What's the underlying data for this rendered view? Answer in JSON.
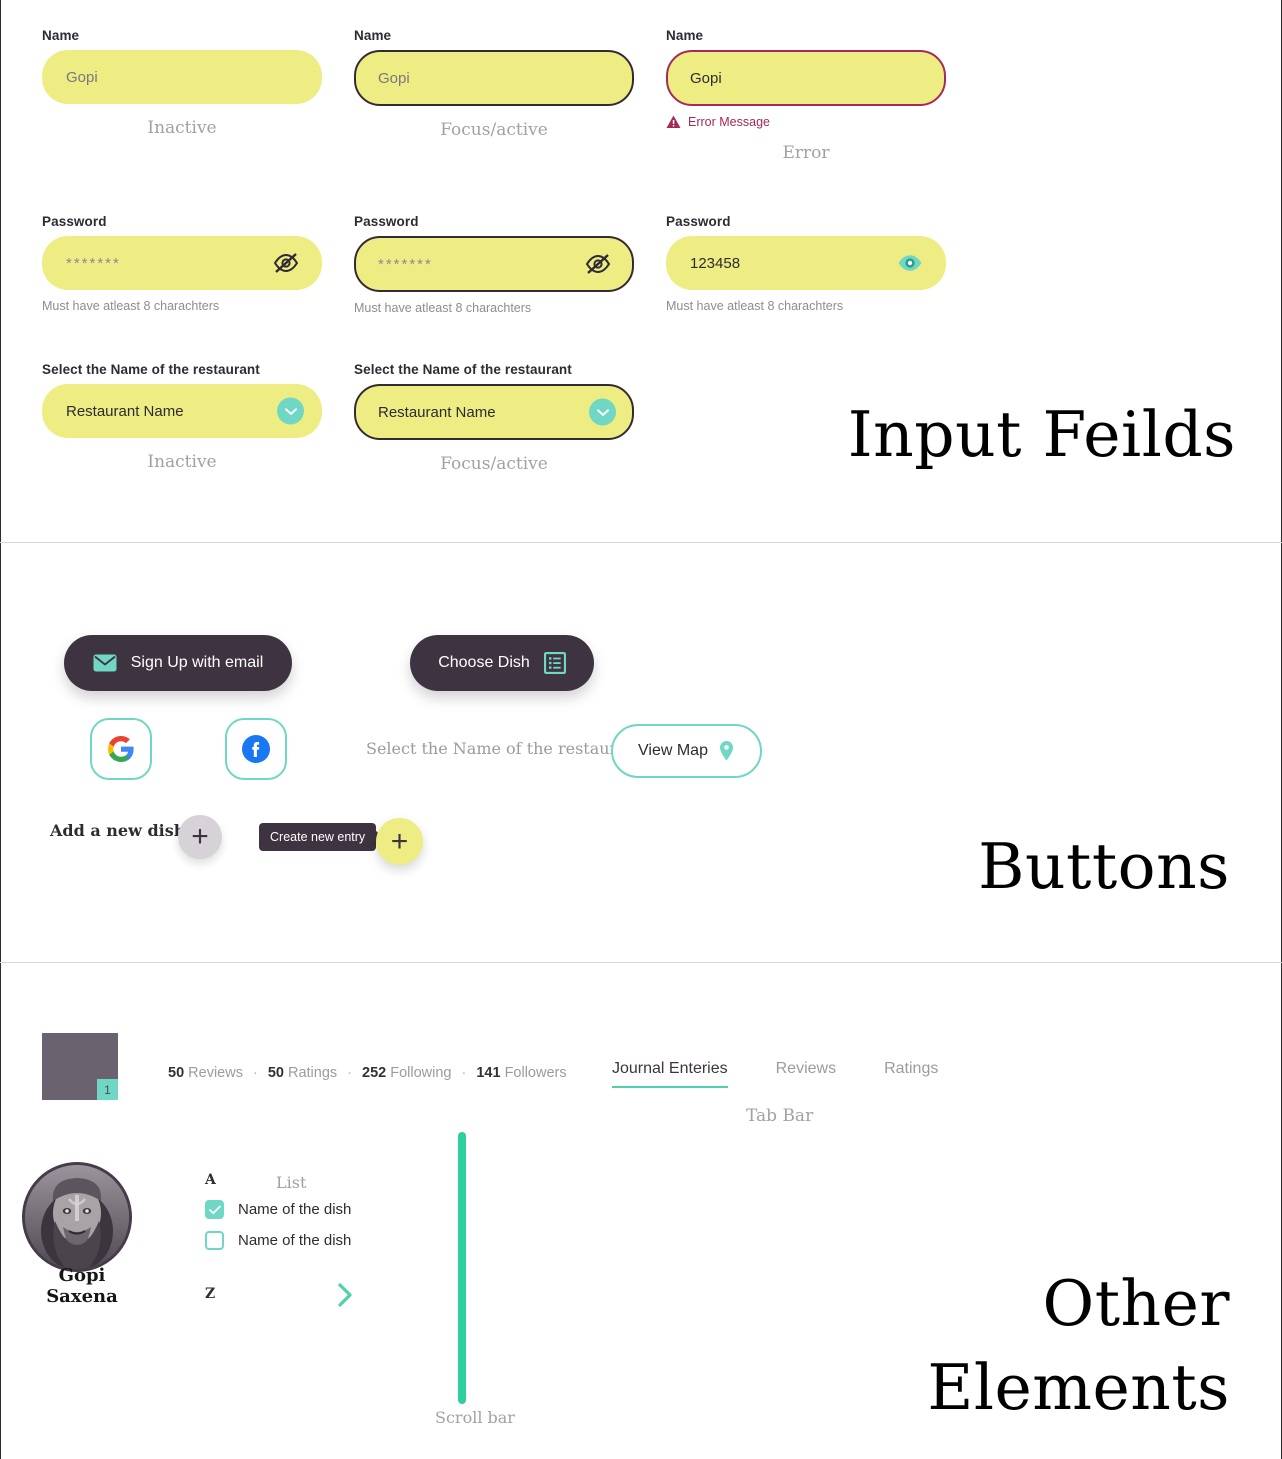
{
  "sections": {
    "input_fields_title": "Input Feilds",
    "buttons_title": "Buttons",
    "other_title_line1": "Other",
    "other_title_line2": "Elements"
  },
  "colors": {
    "field_fill": "#eded83",
    "accent_teal": "#6fd7c3",
    "dark": "#3e3340",
    "error": "#a52a5a",
    "scrollbar": "#2ecf9e"
  },
  "name_fields": [
    {
      "label": "Name",
      "value": "Gopi",
      "state_caption": "Inactive"
    },
    {
      "label": "Name",
      "value": "Gopi",
      "state_caption": "Focus/active"
    },
    {
      "label": "Name",
      "value": "Gopi",
      "state_caption": "Error",
      "error_message": "Error Message"
    }
  ],
  "password_fields": [
    {
      "label": "Password",
      "value": "*******",
      "helper": "Must have atleast 8 charachters",
      "icon": "eye-off-icon"
    },
    {
      "label": "Password",
      "value": "*******",
      "helper": "Must have atleast 8 charachters",
      "icon": "eye-off-icon"
    },
    {
      "label": "Password",
      "value": "123458",
      "helper": "Must have atleast 8 charachters",
      "icon": "eye-icon"
    }
  ],
  "select_fields": [
    {
      "label": "Select the Name of the restaurant",
      "value": "Restaurant Name",
      "state_caption": "Inactive"
    },
    {
      "label": "Select the Name of the restaurant",
      "value": "Restaurant Name",
      "state_caption": "Focus/active"
    }
  ],
  "buttons": {
    "signup_email": "Sign Up with email",
    "choose_dish": "Choose Dish",
    "google": "google-icon",
    "facebook": "facebook-icon",
    "select_restaurant_hint": "Select the Name of the restaurant",
    "view_map": "View Map",
    "add_new_dish": "Add a new dish",
    "create_new_entry_tooltip": "Create new entry",
    "plus": "+"
  },
  "other": {
    "thumb_badge": "1",
    "stats": [
      {
        "count": "50",
        "label": "Reviews"
      },
      {
        "count": "50",
        "label": "Ratings"
      },
      {
        "count": "252",
        "label": "Following"
      },
      {
        "count": "141",
        "label": "Followers"
      }
    ],
    "stats_separator": "·",
    "tabs": [
      {
        "label": "Journal Enteries",
        "active": true
      },
      {
        "label": "Reviews",
        "active": false
      },
      {
        "label": "Ratings",
        "active": false
      }
    ],
    "tabbar_caption": "Tab Bar",
    "profile_name": "Gopi Saxena",
    "list_caption": "List",
    "alpha_top": "A",
    "alpha_bottom": "Z",
    "list_items": [
      {
        "label": "Name of the dish",
        "checked": true
      },
      {
        "label": "Name of the dish",
        "checked": false
      }
    ],
    "scrollbar_caption": "Scroll bar"
  }
}
